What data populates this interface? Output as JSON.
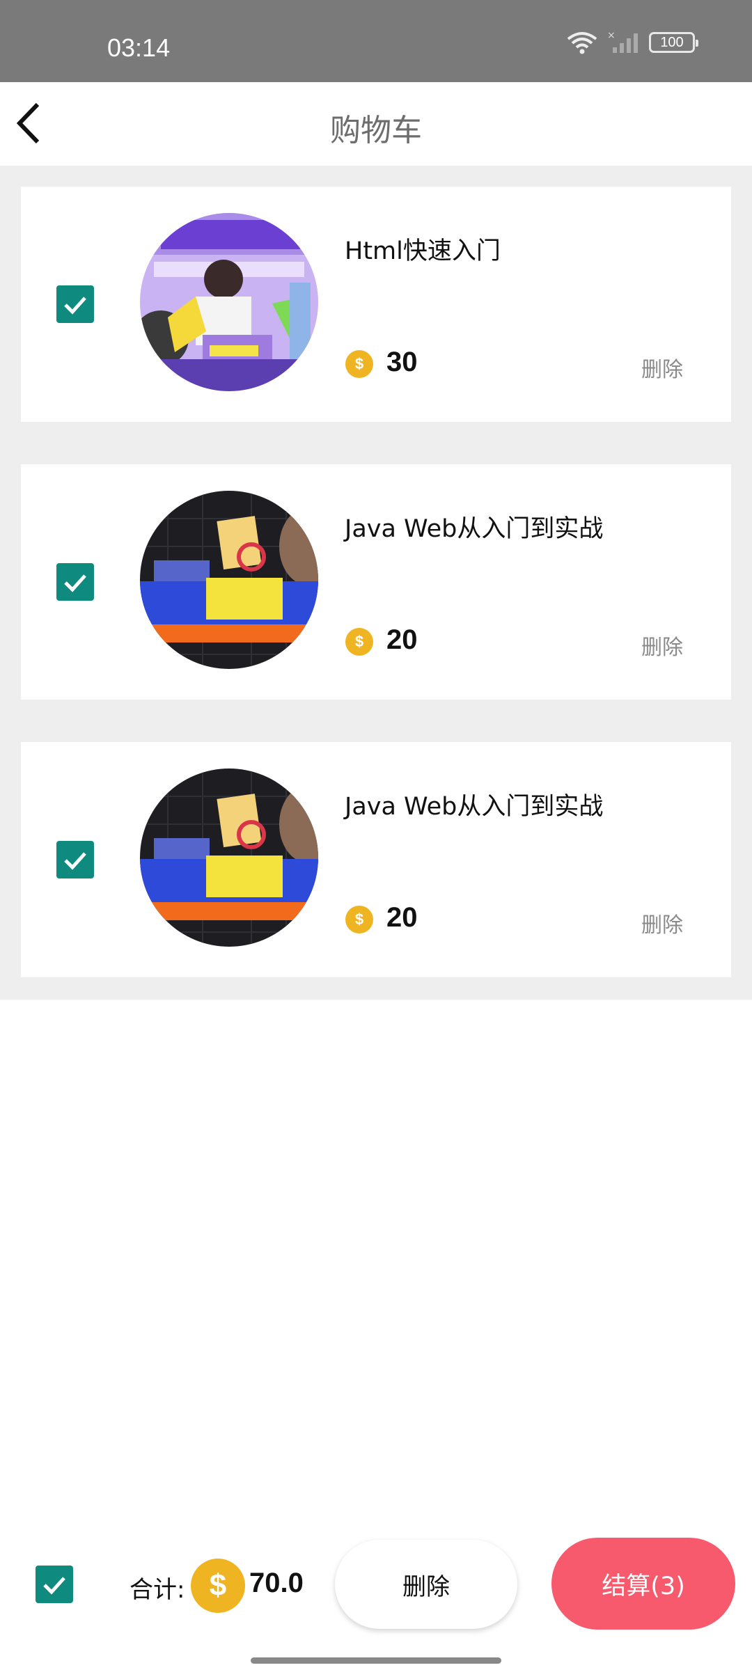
{
  "status_bar": {
    "time": "03:14",
    "battery": "100"
  },
  "header": {
    "title": "购物车"
  },
  "cart": {
    "items": [
      {
        "title": "Html快速入门",
        "price": "30",
        "delete_label": "删除",
        "checked": true,
        "currency_icon": "coin-icon"
      },
      {
        "title": "Java Web从入门到实战",
        "price": "20",
        "delete_label": "删除",
        "checked": true,
        "currency_icon": "coin-icon"
      },
      {
        "title": "Java Web从入门到实战",
        "price": "20",
        "delete_label": "删除",
        "checked": true,
        "currency_icon": "coin-icon"
      }
    ]
  },
  "footer": {
    "total_label": "合计:",
    "total_value": "70.0",
    "delete_button": "删除",
    "checkout_button": "结算(3)",
    "select_all_checked": true
  },
  "colors": {
    "accent": "#0f8a7e",
    "coin": "#efb421",
    "checkout": "#f65a6c",
    "status_bar": "#7a7a7a"
  }
}
